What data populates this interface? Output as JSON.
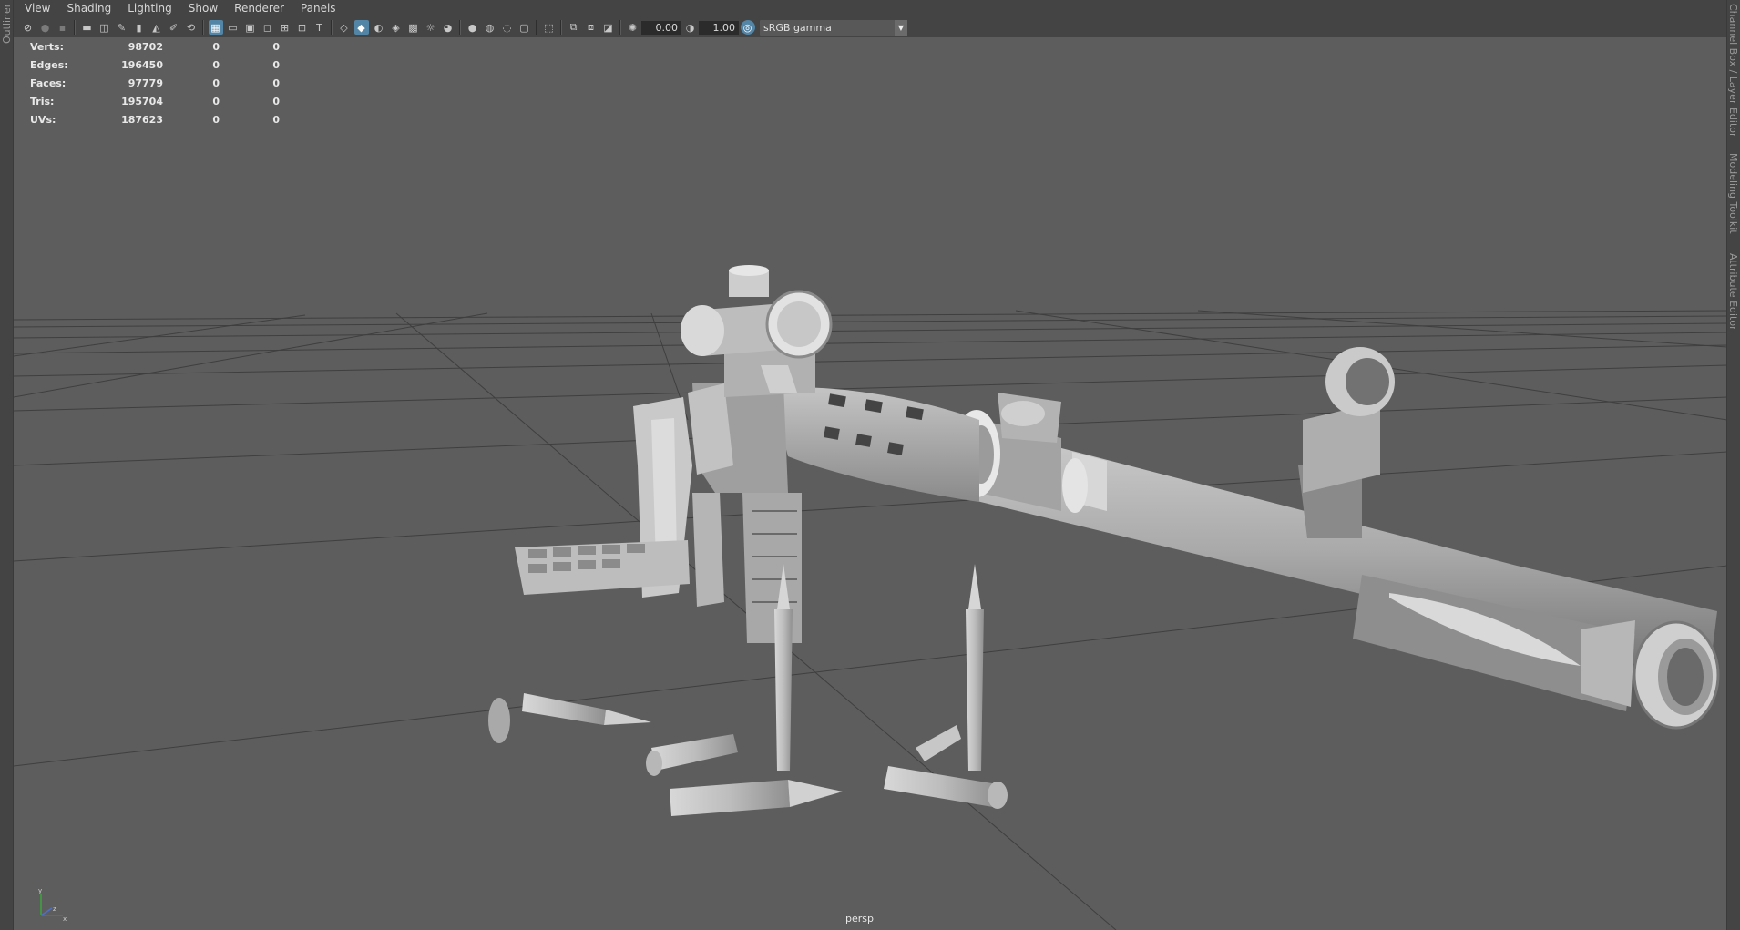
{
  "left_panel": {
    "tab": "Outliner"
  },
  "right_panel": {
    "tabs": [
      "Channel Box / Layer Editor",
      "Modeling Toolkit",
      "Attribute Editor"
    ]
  },
  "menubar": {
    "items": [
      "View",
      "Shading",
      "Lighting",
      "Show",
      "Renderer",
      "Panels"
    ]
  },
  "toolbar": {
    "exposure_value": "0.00",
    "gamma_value": "1.00",
    "color_space": "sRGB gamma",
    "icons": [
      "select-camera-icon",
      "lock-camera-icon",
      "camera-attributes-icon",
      "image-plane-icon",
      "2d-pan-zoom-icon",
      "grease-pencil-icon",
      "bookmark-icon",
      "camera-icon",
      "grid-icon",
      "film-gate-icon",
      "resolution-gate-icon",
      "gate-mask-icon",
      "field-chart-icon",
      "safe-action-icon",
      "safe-title-icon",
      "wireframe-icon",
      "smooth-shade-icon",
      "default-material-icon",
      "textured-icon",
      "use-all-lights-icon",
      "shadows-icon",
      "screen-space-ao-icon",
      "motion-blur-icon",
      "anti-aliasing-icon",
      "depth-of-field-icon",
      "isolate-select-icon",
      "xray-icon",
      "xray-joints-icon",
      "xray-components-icon",
      "exposure-icon",
      "gamma-icon",
      "color-management-icon"
    ]
  },
  "hud": {
    "rows": [
      {
        "label": "Verts:",
        "v1": "98702",
        "v2": "0",
        "v3": "0"
      },
      {
        "label": "Edges:",
        "v1": "196450",
        "v2": "0",
        "v3": "0"
      },
      {
        "label": "Faces:",
        "v1": "97779",
        "v2": "0",
        "v3": "0"
      },
      {
        "label": "Tris:",
        "v1": "195704",
        "v2": "0",
        "v3": "0"
      },
      {
        "label": "UVs:",
        "v1": "187623",
        "v2": "0",
        "v3": "0"
      }
    ]
  },
  "viewport": {
    "camera": "persp"
  },
  "axis_gizmo": {
    "x": "x",
    "y": "y",
    "z": "z"
  },
  "colors": {
    "viewport_bg": "#5d5d5d",
    "model": "#b9b9b9",
    "grid": "#3e3e3e",
    "ui_bg": "#444444",
    "active_icon": "#5285a6"
  }
}
